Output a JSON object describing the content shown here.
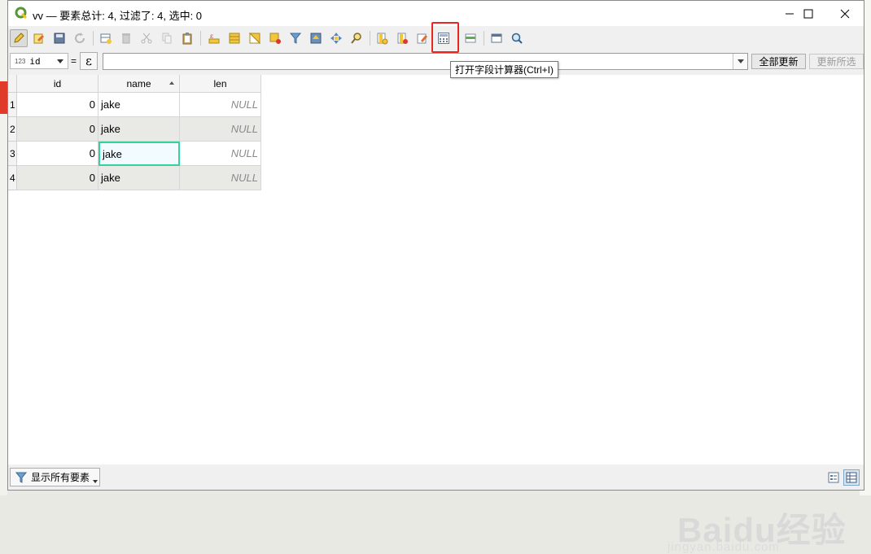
{
  "window": {
    "title": "vv — 要素总计: 4, 过滤了: 4, 选中: 0"
  },
  "toolbar": {
    "tooltip": "打开字段计算器(Ctrl+I)"
  },
  "formbar": {
    "field_type_badge": "123",
    "field_name": "id",
    "equals": "=",
    "expression_button": "ε",
    "expression_value": "",
    "update_all": "全部更新",
    "update_selected": "更新所选"
  },
  "table": {
    "columns": [
      "id",
      "name",
      "len"
    ],
    "rows": [
      {
        "num": "1",
        "id": "0",
        "name": "jake",
        "len": "NULL"
      },
      {
        "num": "2",
        "id": "0",
        "name": "jake",
        "len": "NULL"
      },
      {
        "num": "3",
        "id": "0",
        "name": "jake",
        "len": "NULL"
      },
      {
        "num": "4",
        "id": "0",
        "name": "jake",
        "len": "NULL"
      }
    ]
  },
  "bottom": {
    "show_all": "显示所有要素"
  },
  "watermark": {
    "brand": "Baidu经验",
    "url": "jingyan.baidu.com"
  },
  "colors": {
    "highlight_box": "#e8271e",
    "focus_cell": "#34d39a",
    "qgis_green": "#589632"
  }
}
